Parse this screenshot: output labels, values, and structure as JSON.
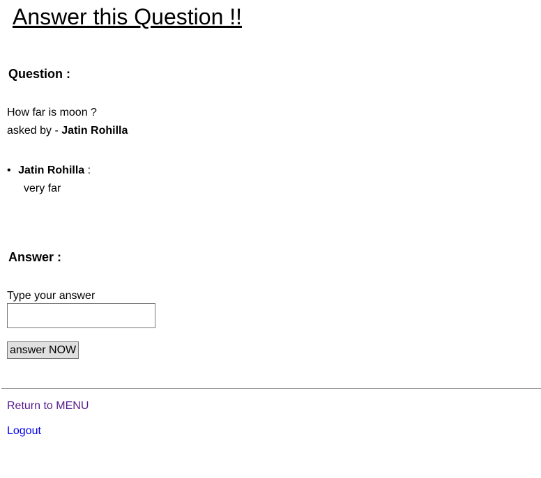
{
  "title": "Answer this Question !!",
  "question": {
    "heading": "Question :",
    "text": "How far is moon ?",
    "asked_by_label": "asked by - ",
    "asked_by": "Jatin Rohilla"
  },
  "answers": [
    {
      "author": "Jatin Rohilla",
      "sep": " :",
      "text": "very far"
    }
  ],
  "answer_form": {
    "heading": "Answer :",
    "label": "Type your answer",
    "value": "",
    "submit": "answer NOW"
  },
  "links": {
    "menu": "Return to MENU",
    "logout": "Logout",
    "visited_color": "#551a8b",
    "link_color": "#0000ee"
  }
}
